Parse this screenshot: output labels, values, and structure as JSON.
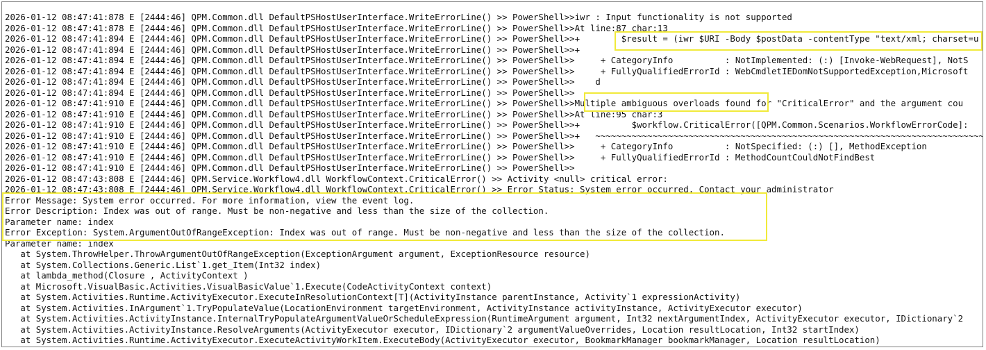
{
  "log_lines": [
    "2026-01-12 08:47:41:878 E [2444:46] QPM.Common.dll DefaultPSHostUserInterface.WriteErrorLine() >> PowerShell>>iwr : Input functionality is not supported",
    "2026-01-12 08:47:41:878 E [2444:46] QPM.Common.dll DefaultPSHostUserInterface.WriteErrorLine() >> PowerShell>>At line:87 char:13",
    "2026-01-12 08:47:41:894 E [2444:46] QPM.Common.dll DefaultPSHostUserInterface.WriteErrorLine() >> PowerShell>>+        $result = (iwr $URI -Body $postData -contentType \"text/xml; charset=u",
    "2026-01-12 08:47:41:894 E [2444:46] QPM.Common.dll DefaultPSHostUserInterface.WriteErrorLine() >> PowerShell>>+                   ~~~~~~~~~~~~~~~~~~~~~~~~~~~~~~~~~~~~~~~~~~~~~~~~~~~~~~~~~~~~",
    "2026-01-12 08:47:41:894 E [2444:46] QPM.Common.dll DefaultPSHostUserInterface.WriteErrorLine() >> PowerShell>>     + CategoryInfo          : NotImplemented: (:) [Invoke-WebRequest], NotS",
    "2026-01-12 08:47:41:894 E [2444:46] QPM.Common.dll DefaultPSHostUserInterface.WriteErrorLine() >> PowerShell>>     + FullyQualifiedErrorId : WebCmdletIEDomNotSupportedException,Microsoft",
    "2026-01-12 08:47:41:894 E [2444:46] QPM.Common.dll DefaultPSHostUserInterface.WriteErrorLine() >> PowerShell>>    d",
    "2026-01-12 08:47:41:894 E [2444:46] QPM.Common.dll DefaultPSHostUserInterface.WriteErrorLine() >> PowerShell>>",
    "2026-01-12 08:47:41:910 E [2444:46] QPM.Common.dll DefaultPSHostUserInterface.WriteErrorLine() >> PowerShell>>Multiple ambiguous overloads found for \"CriticalError\" and the argument cou",
    "2026-01-12 08:47:41:910 E [2444:46] QPM.Common.dll DefaultPSHostUserInterface.WriteErrorLine() >> PowerShell>>At line:95 char:3",
    "2026-01-12 08:47:41:910 E [2444:46] QPM.Common.dll DefaultPSHostUserInterface.WriteErrorLine() >> PowerShell>>+          $workflow.CriticalError([QPM.Common.Scenarios.WorkflowErrorCode]:",
    "2026-01-12 08:47:41:910 E [2444:46] QPM.Common.dll DefaultPSHostUserInterface.WriteErrorLine() >> PowerShell>>+   ~~~~~~~~~~~~~~~~~~~~~~~~~~~~~~~~~~~~~~~~~~~~~~~~~~~~~~~~~~~~~~~~~~~~~~~~~~~",
    "2026-01-12 08:47:41:910 E [2444:46] QPM.Common.dll DefaultPSHostUserInterface.WriteErrorLine() >> PowerShell>>     + CategoryInfo          : NotSpecified: (:) [], MethodException",
    "2026-01-12 08:47:41:910 E [2444:46] QPM.Common.dll DefaultPSHostUserInterface.WriteErrorLine() >> PowerShell>>     + FullyQualifiedErrorId : MethodCountCouldNotFindBest",
    "2026-01-12 08:47:41:910 E [2444:46] QPM.Common.dll DefaultPSHostUserInterface.WriteErrorLine() >> PowerShell>>",
    "2026-01-12 08:47:43:808 E [2444:46] QPM.Service.Workflow4.dll WorkflowContext.CriticalError() >> Activity <null> critical error:",
    "2026-01-12 08:47:43:808 E [2444:46] QPM.Service.Workflow4.dll WorkflowContext.CriticalError() >> Error Status: System error occurred. Contact your administrator",
    "Error Message: System error occurred. For more information, view the event log.",
    "Error Description: Index was out of range. Must be non-negative and less than the size of the collection.",
    "Parameter name: index",
    "Error Exception: System.ArgumentOutOfRangeException: Index was out of range. Must be non-negative and less than the size of the collection.",
    "Parameter name: index",
    "   at System.ThrowHelper.ThrowArgumentOutOfRangeException(ExceptionArgument argument, ExceptionResource resource)",
    "   at System.Collections.Generic.List`1.get_Item(Int32 index)",
    "   at lambda_method(Closure , ActivityContext )",
    "   at Microsoft.VisualBasic.Activities.VisualBasicValue`1.Execute(CodeActivityContext context)",
    "   at System.Activities.Runtime.ActivityExecutor.ExecuteInResolutionContext[T](ActivityInstance parentInstance, Activity`1 expressionActivity)",
    "   at System.Activities.InArgument`1.TryPopulateValue(LocationEnvironment targetEnvironment, ActivityInstance activityInstance, ActivityExecutor executor)",
    "   at System.Activities.ActivityInstance.InternalTryPopulateArgumentValueOrScheduleExpression(RuntimeArgument argument, Int32 nextArgumentIndex, ActivityExecutor executor, IDictionary`2",
    "   at System.Activities.ActivityInstance.ResolveArguments(ActivityExecutor executor, IDictionary`2 argumentValueOverrides, Location resultLocation, Int32 startIndex)",
    "   at System.Activities.Runtime.ActivityExecutor.ExecuteActivityWorkItem.ExecuteBody(ActivityExecutor executor, BookmarkManager bookmarkManager, Location resultLocation)"
  ],
  "highlight_color": "#f1ea3a"
}
